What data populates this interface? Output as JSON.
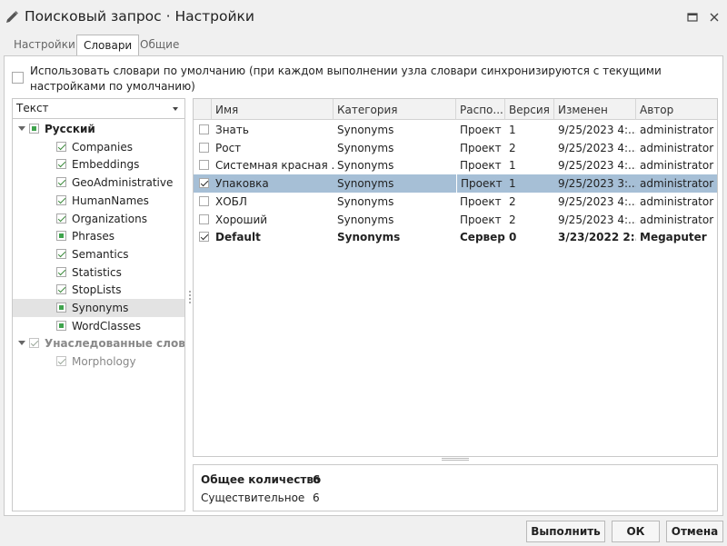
{
  "window": {
    "title": "Поисковый запрос · Настройки",
    "title_icon": "pencil-icon",
    "maximize_icon": "maximize-icon",
    "close_icon": "close-icon"
  },
  "tabs": [
    {
      "label": "Настройки",
      "active": false
    },
    {
      "label": "Словари",
      "active": true
    },
    {
      "label": "Общие",
      "active": false
    }
  ],
  "use_default": {
    "checked": false,
    "label": "Использовать словари по умолчанию (при каждом выполнении узла словари синхронизируются с текущими настройками по умолчанию)"
  },
  "language_select": {
    "value": "Текст"
  },
  "tree": [
    {
      "label": "Русский",
      "level": 0,
      "expanded": true,
      "state": "partial",
      "bold": true
    },
    {
      "label": "Companies",
      "level": 1,
      "state": "checked"
    },
    {
      "label": "Embeddings",
      "level": 1,
      "state": "checked"
    },
    {
      "label": "GeoAdministrative",
      "level": 1,
      "state": "checked"
    },
    {
      "label": "HumanNames",
      "level": 1,
      "state": "checked"
    },
    {
      "label": "Organizations",
      "level": 1,
      "state": "checked"
    },
    {
      "label": "Phrases",
      "level": 1,
      "state": "partial"
    },
    {
      "label": "Semantics",
      "level": 1,
      "state": "checked"
    },
    {
      "label": "Statistics",
      "level": 1,
      "state": "checked"
    },
    {
      "label": "StopLists",
      "level": 1,
      "state": "checked"
    },
    {
      "label": "Synonyms",
      "level": 1,
      "state": "partial",
      "selected": true
    },
    {
      "label": "WordClasses",
      "level": 1,
      "state": "partial"
    },
    {
      "label": "Унаследованные слов...",
      "level": 0,
      "expanded": true,
      "state": "dim-checked",
      "bold": true,
      "muted": true
    },
    {
      "label": "Morphology",
      "level": 1,
      "state": "dim-checked",
      "muted": true
    }
  ],
  "grid": {
    "columns": [
      "Имя",
      "Категория",
      "Распо...",
      "Версия",
      "Изменен",
      "Автор"
    ],
    "rows": [
      {
        "checked": false,
        "name": "Знать",
        "category": "Synonyms",
        "location": "Проект",
        "version": "1",
        "modified": "9/25/2023 4:...",
        "author": "administrator"
      },
      {
        "checked": false,
        "name": "Рост",
        "category": "Synonyms",
        "location": "Проект",
        "version": "2",
        "modified": "9/25/2023 4:...",
        "author": "administrator"
      },
      {
        "checked": false,
        "name": "Системная красная ...",
        "category": "Synonyms",
        "location": "Проект",
        "version": "1",
        "modified": "9/25/2023 4:...",
        "author": "administrator"
      },
      {
        "checked": true,
        "name": "Упаковка",
        "category": "Synonyms",
        "location": "Проект",
        "version": "1",
        "modified": "9/25/2023 3:...",
        "author": "administrator",
        "selected": true
      },
      {
        "checked": false,
        "name": "ХОБЛ",
        "category": "Synonyms",
        "location": "Проект",
        "version": "2",
        "modified": "9/25/2023 4:...",
        "author": "administrator"
      },
      {
        "checked": false,
        "name": "Хороший",
        "category": "Synonyms",
        "location": "Проект",
        "version": "2",
        "modified": "9/25/2023 4:...",
        "author": "administrator"
      },
      {
        "checked": true,
        "name": "Default",
        "category": "Synonyms",
        "location": "Сервер",
        "version": "0",
        "modified": "3/23/2022 2:...",
        "author": "Megaputer",
        "bold": true
      }
    ]
  },
  "summary": [
    {
      "label": "Общее количество",
      "value": "6",
      "bold": true
    },
    {
      "label": "Существительное",
      "value": "6",
      "bold": false
    }
  ],
  "buttons": {
    "run": "Выполнить",
    "ok": "ОК",
    "cancel": "Отмена"
  }
}
